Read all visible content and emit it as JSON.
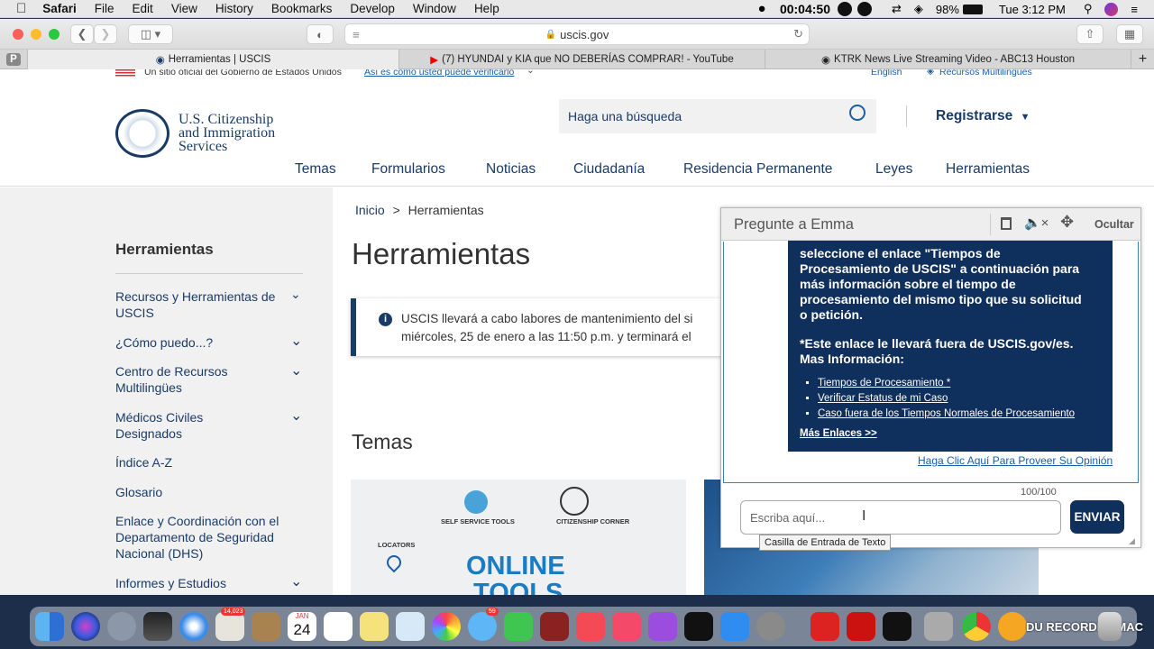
{
  "menubar": {
    "app": "Safari",
    "items": [
      "File",
      "Edit",
      "View",
      "History",
      "Bookmarks",
      "Develop",
      "Window",
      "Help"
    ],
    "recording_time": "00:04:50",
    "battery": "98%",
    "clock": "Tue 3:12 PM"
  },
  "browser": {
    "url": "uscis.gov",
    "tabs": [
      {
        "label": "Herramientas | USCIS"
      },
      {
        "label": "(7) HYUNDAI y KIA que NO DEBERÍAS COMPRAR! - YouTube"
      },
      {
        "label": "KTRK News Live Streaming Video - ABC13 Houston"
      }
    ],
    "pinned_tab": "P",
    "new_tab": "+"
  },
  "gov_banner": {
    "text": "Un sitio oficial del Gobierno de Estados Unidos",
    "link": "Así es como usted puede verificarlo",
    "english": "English",
    "multilingual": "Recursos Multilingües"
  },
  "header": {
    "logo_line1": "U.S. Citizenship",
    "logo_line2": "and Immigration",
    "logo_line3": "Services",
    "search_placeholder": "Haga una búsqueda",
    "register": "Registrarse",
    "nav": [
      "Temas",
      "Formularios",
      "Noticias",
      "Ciudadanía",
      "Residencia Permanente",
      "Leyes",
      "Herramientas"
    ]
  },
  "sidebar": {
    "title": "Herramientas",
    "items": [
      {
        "label": "Recursos y Herramientas de USCIS",
        "expandable": true
      },
      {
        "label": "¿Cómo puedo...?",
        "expandable": true
      },
      {
        "label": "Centro de Recursos Multilingües",
        "expandable": true
      },
      {
        "label": "Médicos Civiles Designados",
        "expandable": true
      },
      {
        "label": "Índice A-Z",
        "expandable": false
      },
      {
        "label": "Glosario",
        "expandable": false
      },
      {
        "label": "Enlace y Coordinación con el Departamento de Seguridad Nacional (DHS)",
        "expandable": false
      },
      {
        "label": "Informes y Estudios",
        "expandable": true
      }
    ]
  },
  "main": {
    "breadcrumb_home": "Inicio",
    "breadcrumb_sep": ">",
    "breadcrumb_current": "Herramientas",
    "title": "Herramientas",
    "alert_line1": "USCIS llevará a cabo labores de mantenimiento del si",
    "alert_line2": "miércoles, 25 de enero a las 11:50 p.m. y terminará el",
    "section_title": "Temas",
    "card_labels": [
      "SELF SERVICE TOOLS",
      "CITIZENSHIP CORNER",
      "LOCATORS",
      "ONLINE",
      "TOOLS"
    ]
  },
  "emma": {
    "title": "Pregunte a Emma",
    "hide": "Ocultar",
    "msg_lines": [
      "seleccione el enlace \"Tiempos de",
      "Procesamiento de USCIS\" a continuación para",
      "más información sobre el tiempo de",
      "procesamiento del mismo tipo que su solicitud",
      "o petición."
    ],
    "msg_note": "*Este enlace le llevará fuera de USCIS.gov/es.",
    "more_info": "Mas Información:",
    "links": [
      "Tiempos de Procesamiento *",
      "Verificar Estatus de mi Caso",
      "Caso fuera de los Tiempos Normales de Procesamiento"
    ],
    "more_links": "Más Enlaces >>",
    "feedback": "Haga Clic Aquí Para Proveer Su Opinión",
    "counter": "100/100",
    "input_placeholder": "Escriba aquí...",
    "send": "ENVIAR",
    "tooltip": "Casilla de Entrada de Texto"
  },
  "dock": {
    "badge_mail": "14,023",
    "calendar_month": "JAN",
    "calendar_day": "24",
    "badge_messages": "59",
    "recorder_label": "DU RECORDER MAC"
  }
}
